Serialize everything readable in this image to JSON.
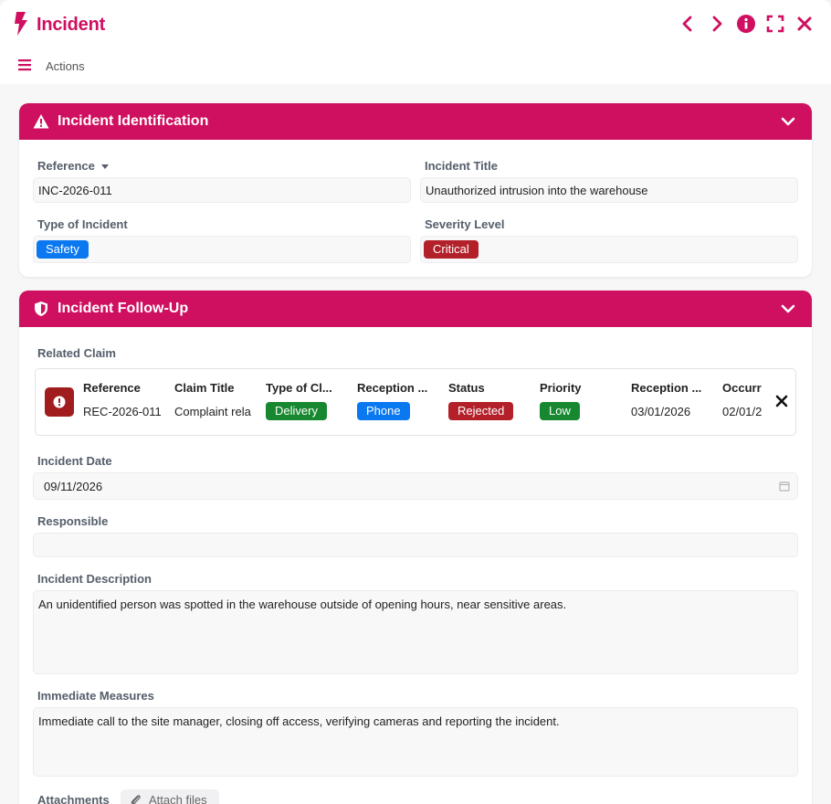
{
  "header": {
    "title": "Incident",
    "brand_color": "#cf0f5f",
    "controls": [
      "chevron-left-icon",
      "chevron-right-icon",
      "info-icon",
      "fullscreen-icon",
      "close-icon"
    ]
  },
  "actions": {
    "label": "Actions"
  },
  "identification": {
    "title": "Incident Identification",
    "reference_label": "Reference",
    "reference_value": "INC-2026-011",
    "title_label": "Incident Title",
    "title_value": "Unauthorized intrusion into the warehouse",
    "type_label": "Type of Incident",
    "type_value": "Safety",
    "severity_label": "Severity Level",
    "severity_value": "Critical"
  },
  "followup": {
    "title": "Incident Follow-Up",
    "related_claim_label": "Related Claim",
    "claim": {
      "headers": [
        "Reference",
        "Claim Title",
        "Type of Cl...",
        "Reception ...",
        "Status",
        "Priority",
        "Reception ...",
        "Occurr"
      ],
      "reference": "REC-2026-011",
      "claim_title": "Complaint rela",
      "type": "Delivery",
      "reception_channel": "Phone",
      "status": "Rejected",
      "priority": "Low",
      "reception_date": "03/01/2026",
      "occurrence_date": "02/01/2"
    },
    "incident_date_label": "Incident Date",
    "incident_date_value": "09/11/2026",
    "responsible_label": "Responsible",
    "responsible_value": "",
    "description_label": "Incident Description",
    "description_value": "An unidentified person was spotted in the warehouse outside of opening hours, near sensitive areas.",
    "measures_label": "Immediate Measures",
    "measures_value": "Immediate call to the site manager, closing off access, verifying cameras and reporting the incident.",
    "attachments_label": "Attachments",
    "attach_button": "Attach files"
  }
}
